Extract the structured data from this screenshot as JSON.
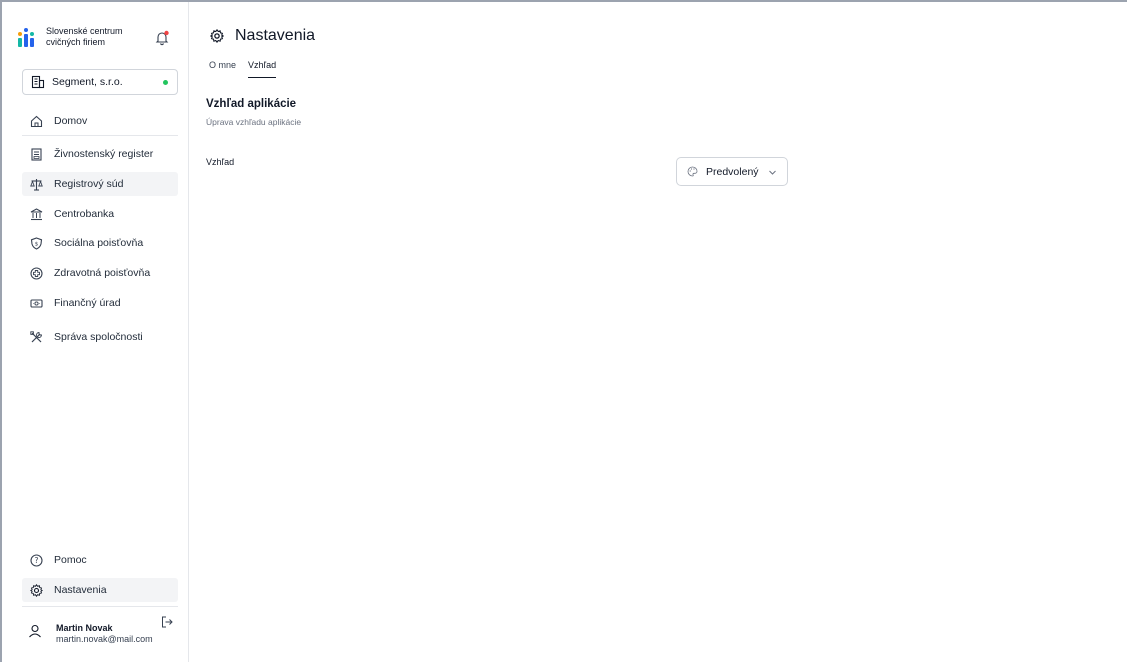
{
  "brand": {
    "line1": "Slovenské centrum",
    "line2": "cvičných firiem"
  },
  "company": {
    "name": "Segment, s.r.o.",
    "status_color": "#22c55e"
  },
  "nav": {
    "home": "Domov",
    "items": [
      "Živnostenský register",
      "Registrový súd",
      "Centrobanka",
      "Sociálna poisťovňa",
      "Zdravotná poisťovňa",
      "Finančný úrad",
      "Správa spoločnosti"
    ],
    "help": "Pomoc",
    "settings": "Nastavenia"
  },
  "user": {
    "name": "Martin Novak",
    "email": "martin.novak@mail.com"
  },
  "page": {
    "title": "Nastavenia",
    "tabs": [
      "O mne",
      "Vzhľad"
    ],
    "active_tab": "Vzhľad",
    "section_title": "Vzhľad aplikácie",
    "section_subtitle": "Úprava vzhľadu aplikácie",
    "field_label": "Vzhľad",
    "select_value": "Predvolený"
  },
  "colors": {
    "logo_teal": "#14b8a6",
    "logo_blue": "#2563eb",
    "logo_yellow": "#f59e0b",
    "bell_badge": "#ef4444"
  }
}
